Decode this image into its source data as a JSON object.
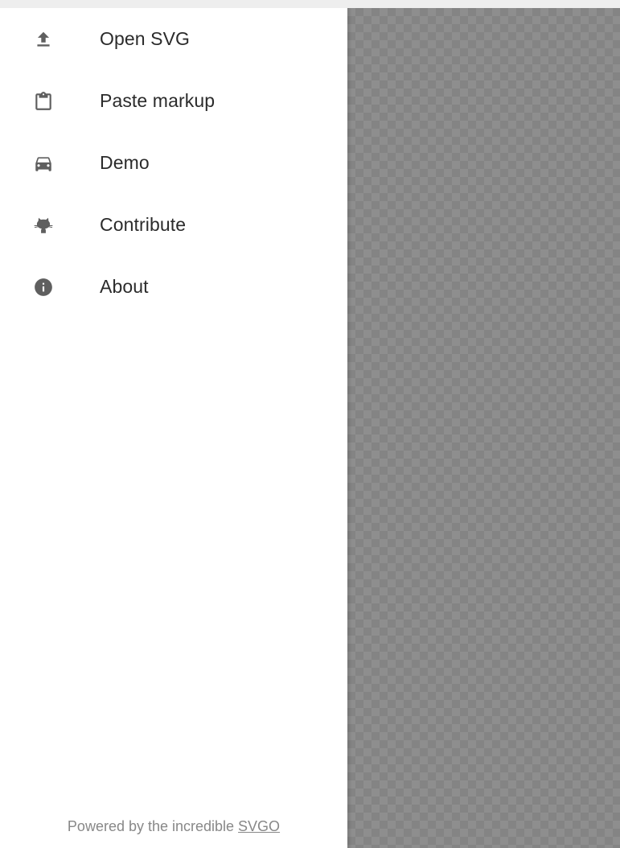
{
  "menu": {
    "items": [
      {
        "id": "open-svg",
        "label": "Open SVG",
        "icon": "upload-icon"
      },
      {
        "id": "paste-markup",
        "label": "Paste markup",
        "icon": "clipboard-icon"
      },
      {
        "id": "demo",
        "label": "Demo",
        "icon": "car-icon"
      },
      {
        "id": "contribute",
        "label": "Contribute",
        "icon": "github-octocat-icon"
      },
      {
        "id": "about",
        "label": "About",
        "icon": "info-icon"
      }
    ]
  },
  "footer": {
    "prefix": "Powered by the incredible ",
    "link_text": "SVGO"
  },
  "colors": {
    "icon": "#5f5f5f",
    "text": "#2b2b2b",
    "footer_text": "#888888",
    "overlay": "#8e8e8e"
  }
}
